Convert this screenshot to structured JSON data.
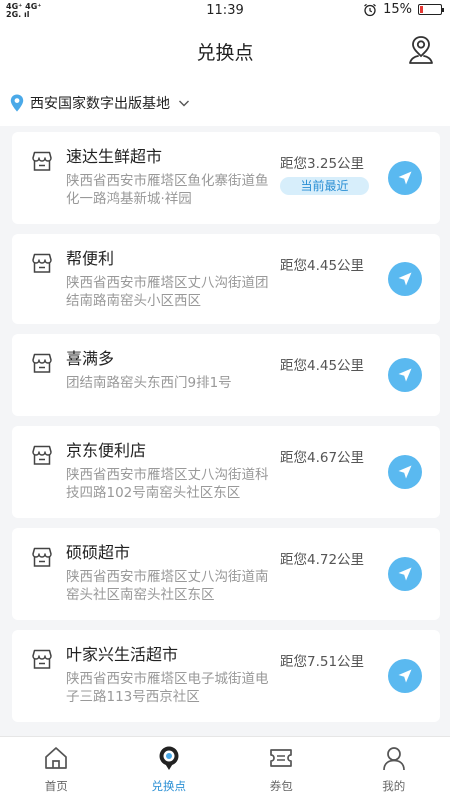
{
  "status_bar": {
    "network_top": "4G⁺ 4G⁺",
    "network_bottom": "2G. ıl",
    "time": "11:39",
    "battery": "15%",
    "battery_level": 0.15
  },
  "header": {
    "title": "兑换点"
  },
  "location": {
    "name": "西安国家数字出版基地"
  },
  "stores": [
    {
      "name": "速达生鲜超市",
      "address": "陕西省西安市雁塔区鱼化寨街道鱼化一路鸿基新城·祥园",
      "distance": "距您3.25公里",
      "badge": "当前最近"
    },
    {
      "name": "帮便利",
      "address": "陕西省西安市雁塔区丈八沟街道团结南路南窑头小区西区",
      "distance": "距您4.45公里"
    },
    {
      "name": "喜满多",
      "address": "团结南路窑头东西门9排1号",
      "distance": "距您4.45公里"
    },
    {
      "name": "京东便利店",
      "address": "陕西省西安市雁塔区丈八沟街道科技四路102号南窑头社区东区",
      "distance": "距您4.67公里"
    },
    {
      "name": "硕硕超市",
      "address": "陕西省西安市雁塔区丈八沟街道南窑头社区南窑头社区东区",
      "distance": "距您4.72公里"
    },
    {
      "name": "叶家兴生活超市",
      "address": "陕西省西安市雁塔区电子城街道电子三路113号西京社区",
      "distance": "距您7.51公里"
    }
  ],
  "tabs": [
    {
      "label": "首页",
      "icon": "home-icon"
    },
    {
      "label": "兑换点",
      "icon": "location-pin-icon",
      "active": true
    },
    {
      "label": "券包",
      "icon": "coupon-icon"
    },
    {
      "label": "我的",
      "icon": "user-icon"
    }
  ],
  "colors": {
    "accent": "#2a8fd4",
    "nav_button": "#5ab9f0",
    "badge_bg": "#d7eefb",
    "battery_low": "#e53935"
  }
}
